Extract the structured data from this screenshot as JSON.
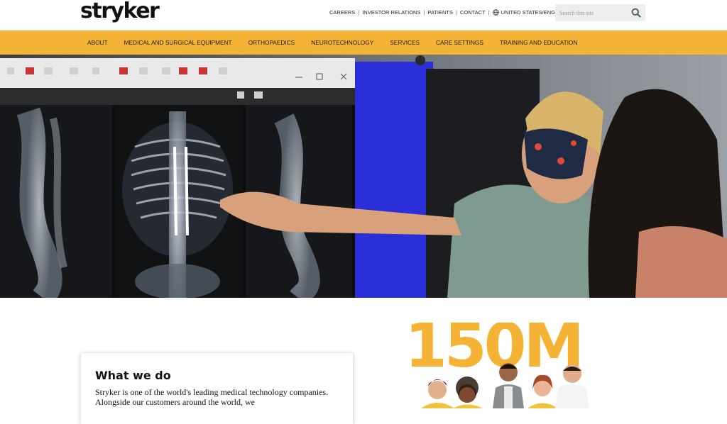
{
  "header": {
    "logo_text": "stryker",
    "utility_links": [
      "CAREERS",
      "INVESTOR RELATIONS",
      "PATIENTS",
      "CONTACT"
    ],
    "locale_label": "UNITED STATES/ENGLISH",
    "search_placeholder": "Search this site"
  },
  "nav": {
    "items": [
      "ABOUT",
      "MEDICAL AND SURGICAL EQUIPMENT",
      "ORTHOPAEDICS",
      "NEUROTECHNOLOGY",
      "SERVICES",
      "CARE SETTINGS",
      "TRAINING AND EDUCATION"
    ]
  },
  "card": {
    "title": "What we do",
    "body": "Stryker is one of the world's leading medical technology companies. Alongside our customers around the world, we"
  },
  "stat": {
    "number": "150M"
  },
  "colors": {
    "accent": "#f5b335",
    "hero_blue": "#2a2fd8",
    "text": "#1a1a1a"
  },
  "icons": {
    "search": "search-icon",
    "locale": "globe-icon"
  }
}
